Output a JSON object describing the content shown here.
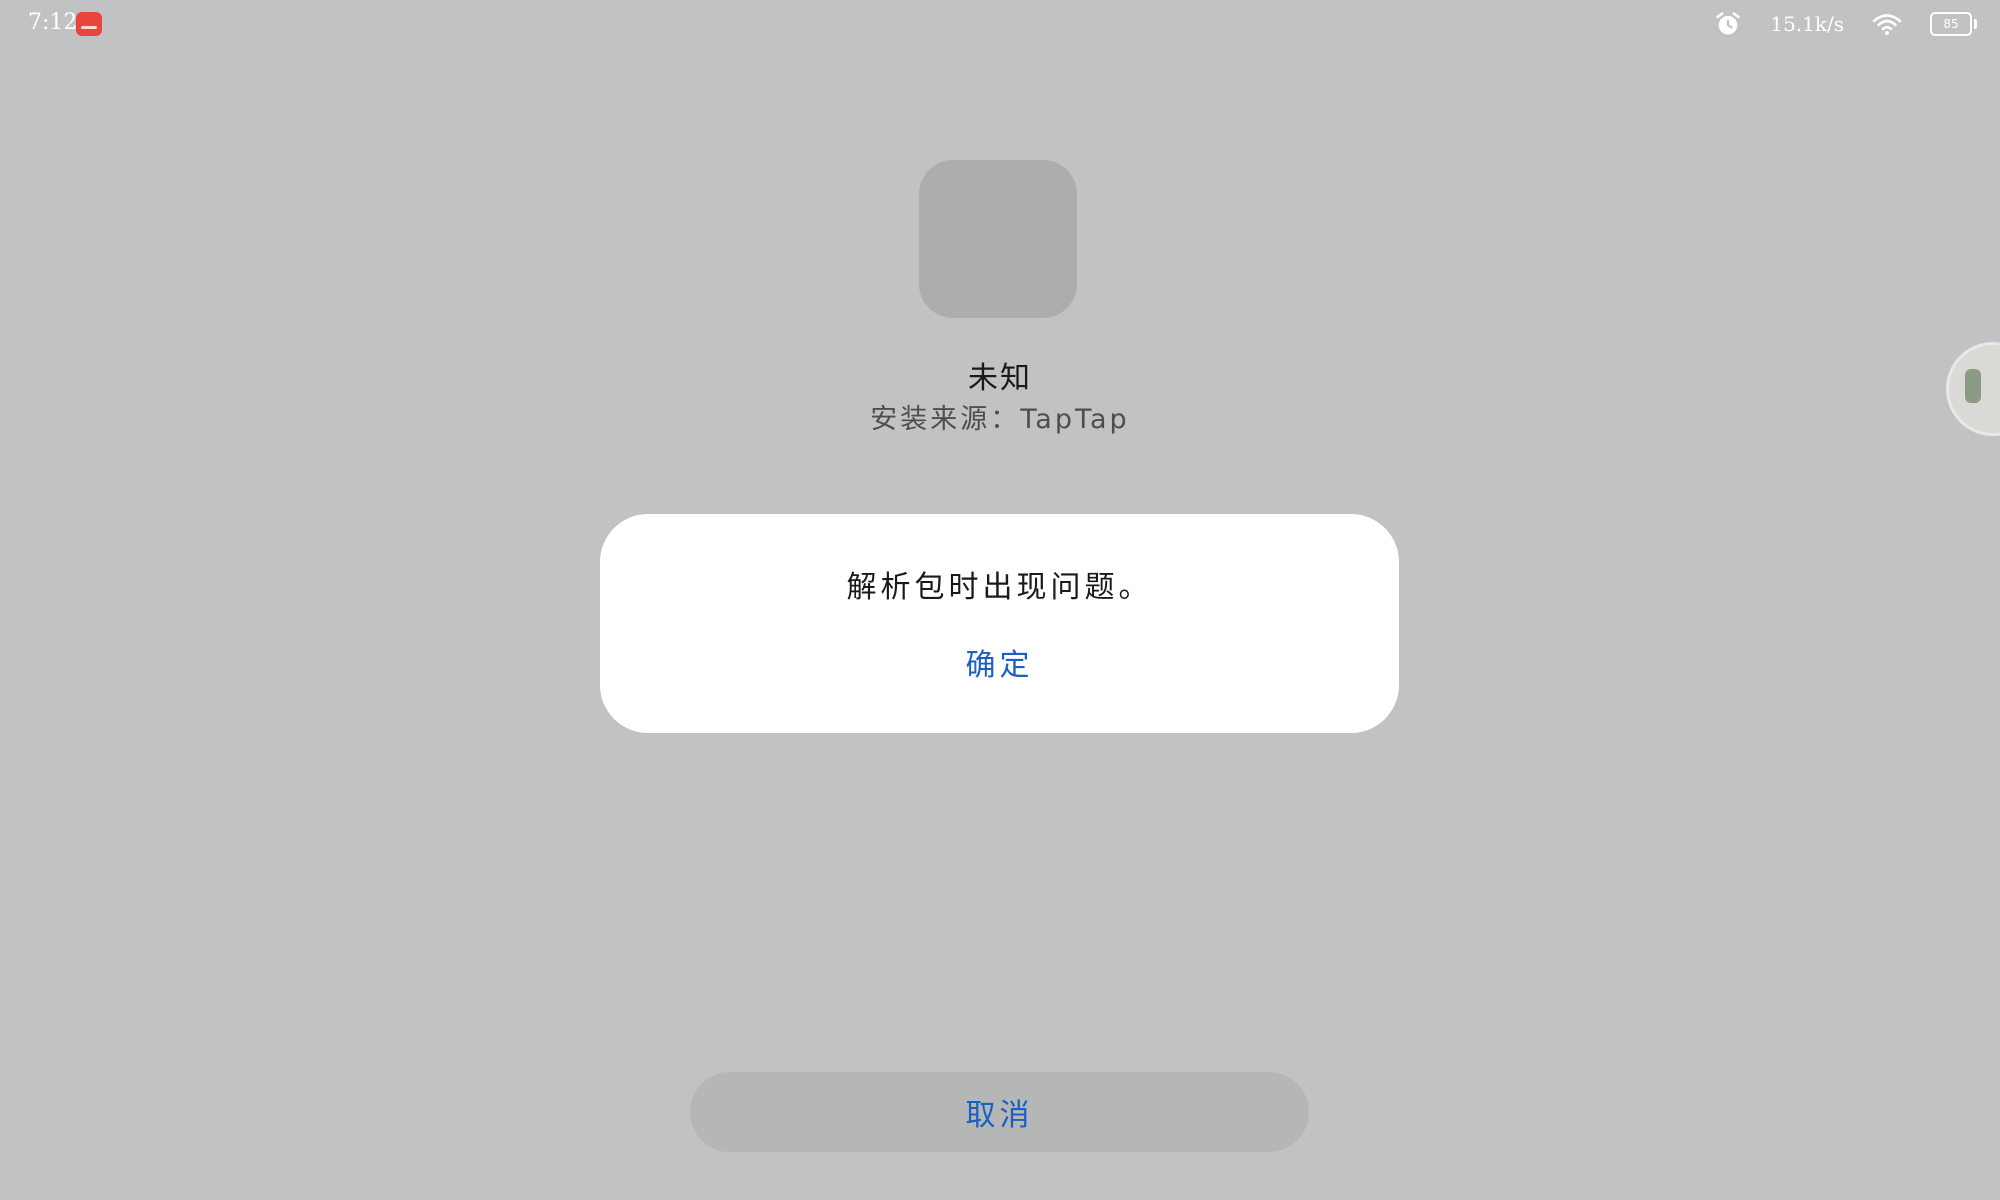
{
  "status_bar": {
    "time": "7:12",
    "net_speed": "15.1k/s",
    "battery_level": "85",
    "icons": [
      "app-store-badge-icon",
      "alarm-icon",
      "wifi-icon",
      "battery-icon"
    ]
  },
  "app_info": {
    "name": "未知",
    "install_source": "安装来源：TapTap"
  },
  "dialog": {
    "message": "解析包时出现问题。",
    "confirm_label": "确定"
  },
  "footer": {
    "cancel_label": "取消"
  },
  "colors": {
    "background": "#c1c2c4",
    "accent_blue": "#1a5fc4",
    "dialog_bg": "#ffffff",
    "cancel_bg": "#b5b6b6"
  }
}
